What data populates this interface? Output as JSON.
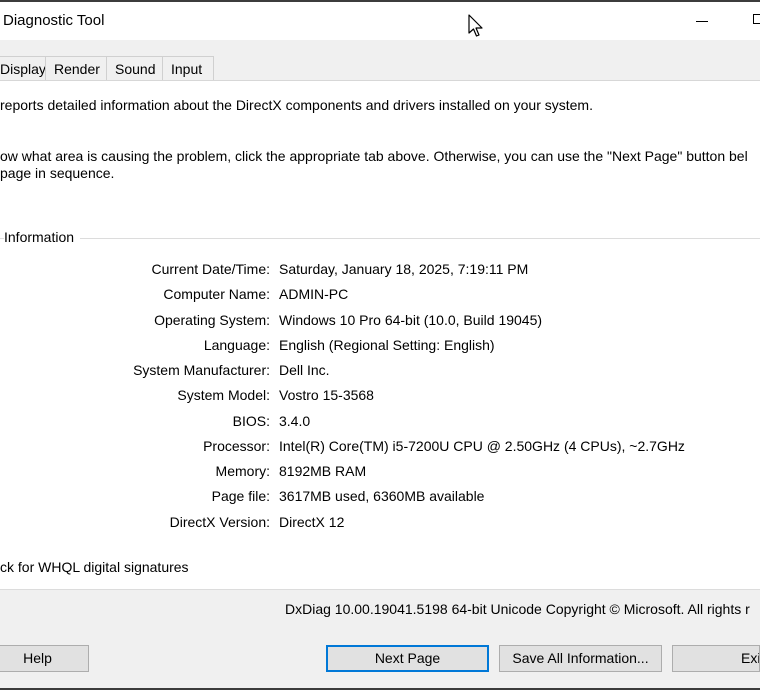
{
  "window": {
    "title": "Diagnostic Tool"
  },
  "tabs": [
    {
      "label": "Display"
    },
    {
      "label": "Render"
    },
    {
      "label": "Sound"
    },
    {
      "label": "Input"
    }
  ],
  "intro": {
    "line1": "reports detailed information about the DirectX components and drivers installed on your system.",
    "line2": "ow what area is causing the problem, click the appropriate tab above.  Otherwise, you can use the \"Next Page\" button bel",
    "line3": "page in sequence."
  },
  "system_info": {
    "group_label": "Information",
    "rows": [
      {
        "label": "Current Date/Time:",
        "value": "Saturday, January 18, 2025, 7:19:11 PM"
      },
      {
        "label": "Computer Name:",
        "value": "ADMIN-PC"
      },
      {
        "label": "Operating System:",
        "value": "Windows 10 Pro 64-bit (10.0, Build 19045)"
      },
      {
        "label": "Language:",
        "value": "English (Regional Setting: English)"
      },
      {
        "label": "System Manufacturer:",
        "value": "Dell Inc."
      },
      {
        "label": "System Model:",
        "value": "Vostro 15-3568"
      },
      {
        "label": "BIOS:",
        "value": "3.4.0"
      },
      {
        "label": "Processor:",
        "value": "Intel(R) Core(TM) i5-7200U CPU @ 2.50GHz (4 CPUs), ~2.7GHz"
      },
      {
        "label": "Memory:",
        "value": "8192MB RAM"
      },
      {
        "label": "Page file:",
        "value": "3617MB used, 6360MB available"
      },
      {
        "label": "DirectX Version:",
        "value": "DirectX 12"
      }
    ]
  },
  "whql": {
    "label": "ck for WHQL digital signatures"
  },
  "footer": {
    "version_text": "DxDiag 10.00.19041.5198 64-bit Unicode  Copyright © Microsoft. All rights r"
  },
  "buttons": {
    "help": "Help",
    "next_page": "Next Page",
    "save_all": "Save All Information...",
    "exit": "Exit"
  },
  "colors": {
    "accent": "#0078d7"
  }
}
